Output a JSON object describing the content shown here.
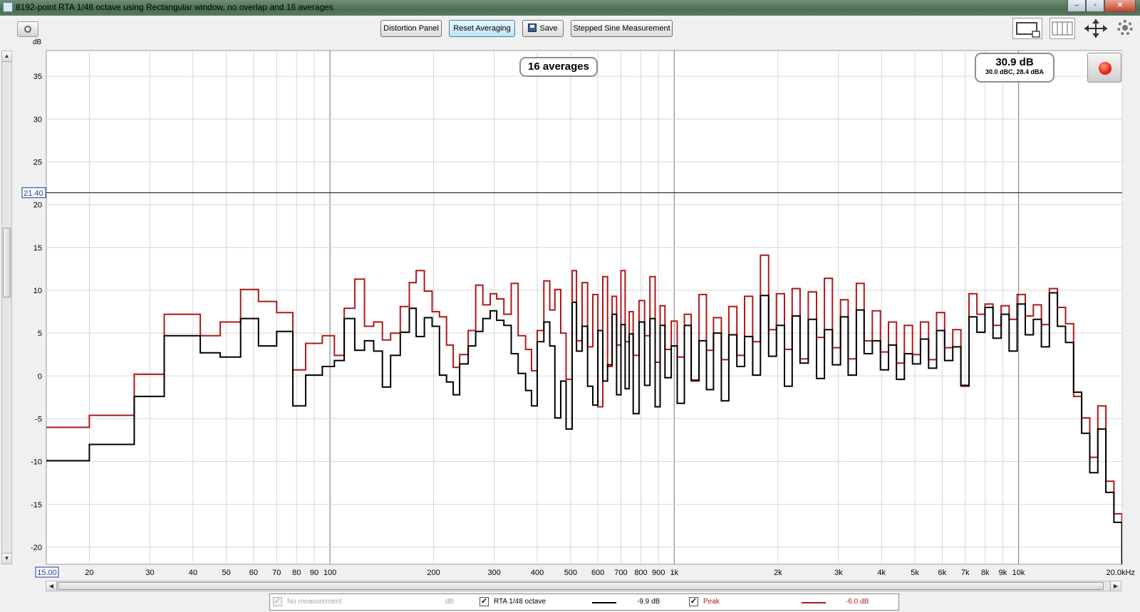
{
  "window": {
    "title": "8192-point RTA 1/48 octave using Rectangular window, no overlap and 16 averages",
    "controls": {
      "minimize": "–",
      "maximize": "▫",
      "close": "✕"
    }
  },
  "toolbar": {
    "distortion_label": "Distortion Panel",
    "reset_label": "Reset Averaging",
    "save_label": "Save",
    "stepped_label": "Stepped Sine Measurement"
  },
  "overlay": {
    "averages_label": "16 averages",
    "level_main": "30.9 dB",
    "level_sub": "30.0 dBC, 28.4 dBA",
    "record_state": "recording"
  },
  "icons": [
    "camera-icon",
    "save-icon",
    "single-view-icon",
    "split-view-icon",
    "fit-arrows-icon",
    "gear-icon",
    "record-icon"
  ],
  "legend": [
    {
      "label": "No measurement",
      "unit": "dB",
      "value": "",
      "checked": true,
      "enabled": false,
      "color": ""
    },
    {
      "label": "RTA 1/48 octave",
      "unit": "",
      "value": "-9.9 dB",
      "checked": true,
      "enabled": true,
      "color": "#000000"
    },
    {
      "label": "Peak",
      "unit": "",
      "value": "-6.0 dB",
      "checked": true,
      "enabled": true,
      "color": "#b01818"
    }
  ],
  "chart_data": {
    "type": "line",
    "title": "",
    "xlabel": "",
    "ylabel": "dB",
    "xscale": "log",
    "xlim": [
      15,
      20000
    ],
    "ylim": [
      -22,
      38
    ],
    "x_tick_labels": [
      "15.00",
      "20",
      "30",
      "40",
      "50",
      "60",
      "70",
      "80",
      "90",
      "100",
      "200",
      "300",
      "400",
      "500",
      "600",
      "700",
      "800",
      "900",
      "1k",
      "2k",
      "3k",
      "4k",
      "5k",
      "6k",
      "7k",
      "8k",
      "9k",
      "10k",
      "20.0kHz"
    ],
    "x_tick_values": [
      15,
      20,
      30,
      40,
      50,
      60,
      70,
      80,
      90,
      100,
      200,
      300,
      400,
      500,
      600,
      700,
      800,
      900,
      1000,
      2000,
      3000,
      4000,
      5000,
      6000,
      7000,
      8000,
      9000,
      10000,
      20000
    ],
    "y_tick_labels": [
      "35",
      "30",
      "25",
      "20",
      "15",
      "10",
      "5",
      "0",
      "-5",
      "-10",
      "-15",
      "-20"
    ],
    "y_tick_values": [
      35,
      30,
      25,
      20,
      15,
      10,
      5,
      0,
      -5,
      -10,
      -15,
      -20
    ],
    "reference_line": {
      "value": 21.4,
      "label": "21.40"
    },
    "grid": true,
    "series": [
      {
        "name": "Peak",
        "color": "#b01818",
        "step": true,
        "points": [
          [
            15,
            -6
          ],
          [
            20,
            -4.6
          ],
          [
            27,
            0.2
          ],
          [
            33,
            7.2
          ],
          [
            42,
            4.7
          ],
          [
            48,
            6.3
          ],
          [
            55,
            10.1
          ],
          [
            62,
            8.7
          ],
          [
            70,
            7.4
          ],
          [
            78,
            0.7
          ],
          [
            85,
            3.8
          ],
          [
            95,
            4.7
          ],
          [
            103,
            2.4
          ],
          [
            110,
            7.9
          ],
          [
            118,
            11.3
          ],
          [
            126,
            5.8
          ],
          [
            134,
            6.3
          ],
          [
            142,
            4.2
          ],
          [
            150,
            5.0
          ],
          [
            160,
            8.1
          ],
          [
            170,
            10.9
          ],
          [
            178,
            12.3
          ],
          [
            188,
            9.9
          ],
          [
            198,
            7.5
          ],
          [
            208,
            6.9
          ],
          [
            218,
            3.6
          ],
          [
            228,
            1.0
          ],
          [
            238,
            2.5
          ],
          [
            252,
            5.3
          ],
          [
            265,
            10.6
          ],
          [
            278,
            8.3
          ],
          [
            292,
            9.6
          ],
          [
            305,
            9.0
          ],
          [
            320,
            7.2
          ],
          [
            336,
            10.8
          ],
          [
            352,
            4.7
          ],
          [
            370,
            3.1
          ],
          [
            385,
            0.6
          ],
          [
            400,
            5.3
          ],
          [
            418,
            11.1
          ],
          [
            435,
            7.7
          ],
          [
            450,
            10.1
          ],
          [
            468,
            5.0
          ],
          [
            485,
            -0.4
          ],
          [
            505,
            12.3
          ],
          [
            520,
            4.1
          ],
          [
            540,
            10.9
          ],
          [
            560,
            3.4
          ],
          [
            580,
            9.5
          ],
          [
            600,
            -3.6
          ],
          [
            620,
            11.6
          ],
          [
            640,
            1.1
          ],
          [
            660,
            9.3
          ],
          [
            680,
            3.6
          ],
          [
            700,
            12.3
          ],
          [
            720,
            4.0
          ],
          [
            740,
            7.5
          ],
          [
            760,
            2.4
          ],
          [
            790,
            8.8
          ],
          [
            820,
            4.7
          ],
          [
            850,
            11.6
          ],
          [
            880,
            1.6
          ],
          [
            910,
            8.2
          ],
          [
            940,
            3.1
          ],
          [
            980,
            6.4
          ],
          [
            1020,
            2.2
          ],
          [
            1070,
            7.2
          ],
          [
            1120,
            -0.6
          ],
          [
            1180,
            9.5
          ],
          [
            1240,
            3.0
          ],
          [
            1300,
            6.8
          ],
          [
            1370,
            1.9
          ],
          [
            1440,
            8.1
          ],
          [
            1520,
            2.4
          ],
          [
            1600,
            9.3
          ],
          [
            1690,
            4.0
          ],
          [
            1780,
            14.1
          ],
          [
            1880,
            5.4
          ],
          [
            1980,
            9.6
          ],
          [
            2090,
            3.1
          ],
          [
            2200,
            10.2
          ],
          [
            2320,
            2.0
          ],
          [
            2450,
            9.8
          ],
          [
            2590,
            4.5
          ],
          [
            2730,
            11.4
          ],
          [
            2880,
            3.3
          ],
          [
            3040,
            8.9
          ],
          [
            3200,
            2.0
          ],
          [
            3380,
            10.8
          ],
          [
            3560,
            4.1
          ],
          [
            3760,
            7.6
          ],
          [
            3970,
            2.8
          ],
          [
            4190,
            6.3
          ],
          [
            4420,
            1.5
          ],
          [
            4660,
            5.9
          ],
          [
            4920,
            2.5
          ],
          [
            5190,
            6.3
          ],
          [
            5480,
            1.9
          ],
          [
            5780,
            7.4
          ],
          [
            6100,
            3.3
          ],
          [
            6440,
            5.4
          ],
          [
            6800,
            -1.2
          ],
          [
            7180,
            9.6
          ],
          [
            7570,
            7.2
          ],
          [
            7990,
            8.4
          ],
          [
            8430,
            5.9
          ],
          [
            8900,
            8.2
          ],
          [
            9390,
            6.6
          ],
          [
            9910,
            9.5
          ],
          [
            10460,
            7.0
          ],
          [
            11040,
            8.3
          ],
          [
            11650,
            6.0
          ],
          [
            12290,
            10.2
          ],
          [
            12970,
            8.0
          ],
          [
            13690,
            6.1
          ],
          [
            14450,
            -2.4
          ],
          [
            15250,
            -4.9
          ],
          [
            16100,
            -9.5
          ],
          [
            16990,
            -3.5
          ],
          [
            17930,
            -12.3
          ],
          [
            18920,
            -16.1
          ],
          [
            19970,
            -21.9
          ]
        ]
      },
      {
        "name": "RTA 1/48 octave",
        "color": "#000000",
        "step": true,
        "points": [
          [
            15,
            -9.9
          ],
          [
            20,
            -8.0
          ],
          [
            27,
            -2.4
          ],
          [
            33,
            4.7
          ],
          [
            42,
            2.7
          ],
          [
            48,
            2.2
          ],
          [
            55,
            6.7
          ],
          [
            62,
            3.5
          ],
          [
            70,
            5.2
          ],
          [
            78,
            -3.5
          ],
          [
            85,
            0.1
          ],
          [
            95,
            1.1
          ],
          [
            103,
            1.8
          ],
          [
            110,
            6.7
          ],
          [
            118,
            3.0
          ],
          [
            126,
            4.1
          ],
          [
            134,
            2.9
          ],
          [
            142,
            -1.3
          ],
          [
            150,
            2.4
          ],
          [
            160,
            5.1
          ],
          [
            170,
            7.9
          ],
          [
            178,
            4.6
          ],
          [
            188,
            6.8
          ],
          [
            198,
            5.8
          ],
          [
            208,
            0.1
          ],
          [
            218,
            -0.7
          ],
          [
            228,
            -2.2
          ],
          [
            238,
            1.4
          ],
          [
            252,
            3.5
          ],
          [
            265,
            5.2
          ],
          [
            278,
            6.7
          ],
          [
            292,
            7.6
          ],
          [
            305,
            6.5
          ],
          [
            320,
            5.9
          ],
          [
            336,
            2.6
          ],
          [
            352,
            0.3
          ],
          [
            370,
            -1.7
          ],
          [
            385,
            -3.5
          ],
          [
            400,
            4.0
          ],
          [
            418,
            6.3
          ],
          [
            435,
            3.5
          ],
          [
            450,
            -4.9
          ],
          [
            468,
            -0.6
          ],
          [
            485,
            -6.2
          ],
          [
            505,
            8.6
          ],
          [
            520,
            2.9
          ],
          [
            540,
            5.8
          ],
          [
            560,
            -1.2
          ],
          [
            580,
            -3.4
          ],
          [
            600,
            5.3
          ],
          [
            620,
            -0.6
          ],
          [
            640,
            1.3
          ],
          [
            660,
            7.2
          ],
          [
            680,
            -2.2
          ],
          [
            700,
            6.0
          ],
          [
            720,
            -1.5
          ],
          [
            740,
            4.9
          ],
          [
            760,
            -4.4
          ],
          [
            790,
            6.3
          ],
          [
            820,
            -1.1
          ],
          [
            850,
            6.7
          ],
          [
            880,
            -3.6
          ],
          [
            910,
            5.9
          ],
          [
            940,
            -0.2
          ],
          [
            980,
            3.5
          ],
          [
            1020,
            -3.2
          ],
          [
            1070,
            5.9
          ],
          [
            1120,
            -0.5
          ],
          [
            1180,
            4.1
          ],
          [
            1240,
            -1.6
          ],
          [
            1300,
            5.0
          ],
          [
            1370,
            -2.9
          ],
          [
            1440,
            4.8
          ],
          [
            1520,
            1.1
          ],
          [
            1600,
            4.6
          ],
          [
            1690,
            0.1
          ],
          [
            1780,
            9.4
          ],
          [
            1880,
            2.3
          ],
          [
            1980,
            5.9
          ],
          [
            2090,
            -1.2
          ],
          [
            2200,
            7.0
          ],
          [
            2320,
            1.5
          ],
          [
            2450,
            6.6
          ],
          [
            2590,
            -0.3
          ],
          [
            2730,
            5.4
          ],
          [
            2880,
            1.3
          ],
          [
            3040,
            6.9
          ],
          [
            3200,
            0.1
          ],
          [
            3380,
            7.7
          ],
          [
            3560,
            2.6
          ],
          [
            3760,
            4.1
          ],
          [
            3970,
            0.7
          ],
          [
            4190,
            3.6
          ],
          [
            4420,
            -0.4
          ],
          [
            4660,
            2.6
          ],
          [
            4920,
            1.4
          ],
          [
            5190,
            4.3
          ],
          [
            5480,
            0.9
          ],
          [
            5780,
            5.3
          ],
          [
            6100,
            1.8
          ],
          [
            6440,
            3.4
          ],
          [
            6800,
            -1.1
          ],
          [
            7180,
            6.9
          ],
          [
            7570,
            5.1
          ],
          [
            7990,
            8.0
          ],
          [
            8430,
            4.4
          ],
          [
            8900,
            7.2
          ],
          [
            9390,
            2.9
          ],
          [
            9910,
            8.4
          ],
          [
            10460,
            4.8
          ],
          [
            11040,
            6.6
          ],
          [
            11650,
            3.4
          ],
          [
            12290,
            9.7
          ],
          [
            12970,
            5.8
          ],
          [
            13690,
            3.9
          ],
          [
            14450,
            -1.9
          ],
          [
            15250,
            -6.7
          ],
          [
            16100,
            -11.3
          ],
          [
            16990,
            -6.2
          ],
          [
            17930,
            -13.6
          ],
          [
            18920,
            -17.1
          ],
          [
            19970,
            -22.0
          ]
        ]
      }
    ]
  }
}
